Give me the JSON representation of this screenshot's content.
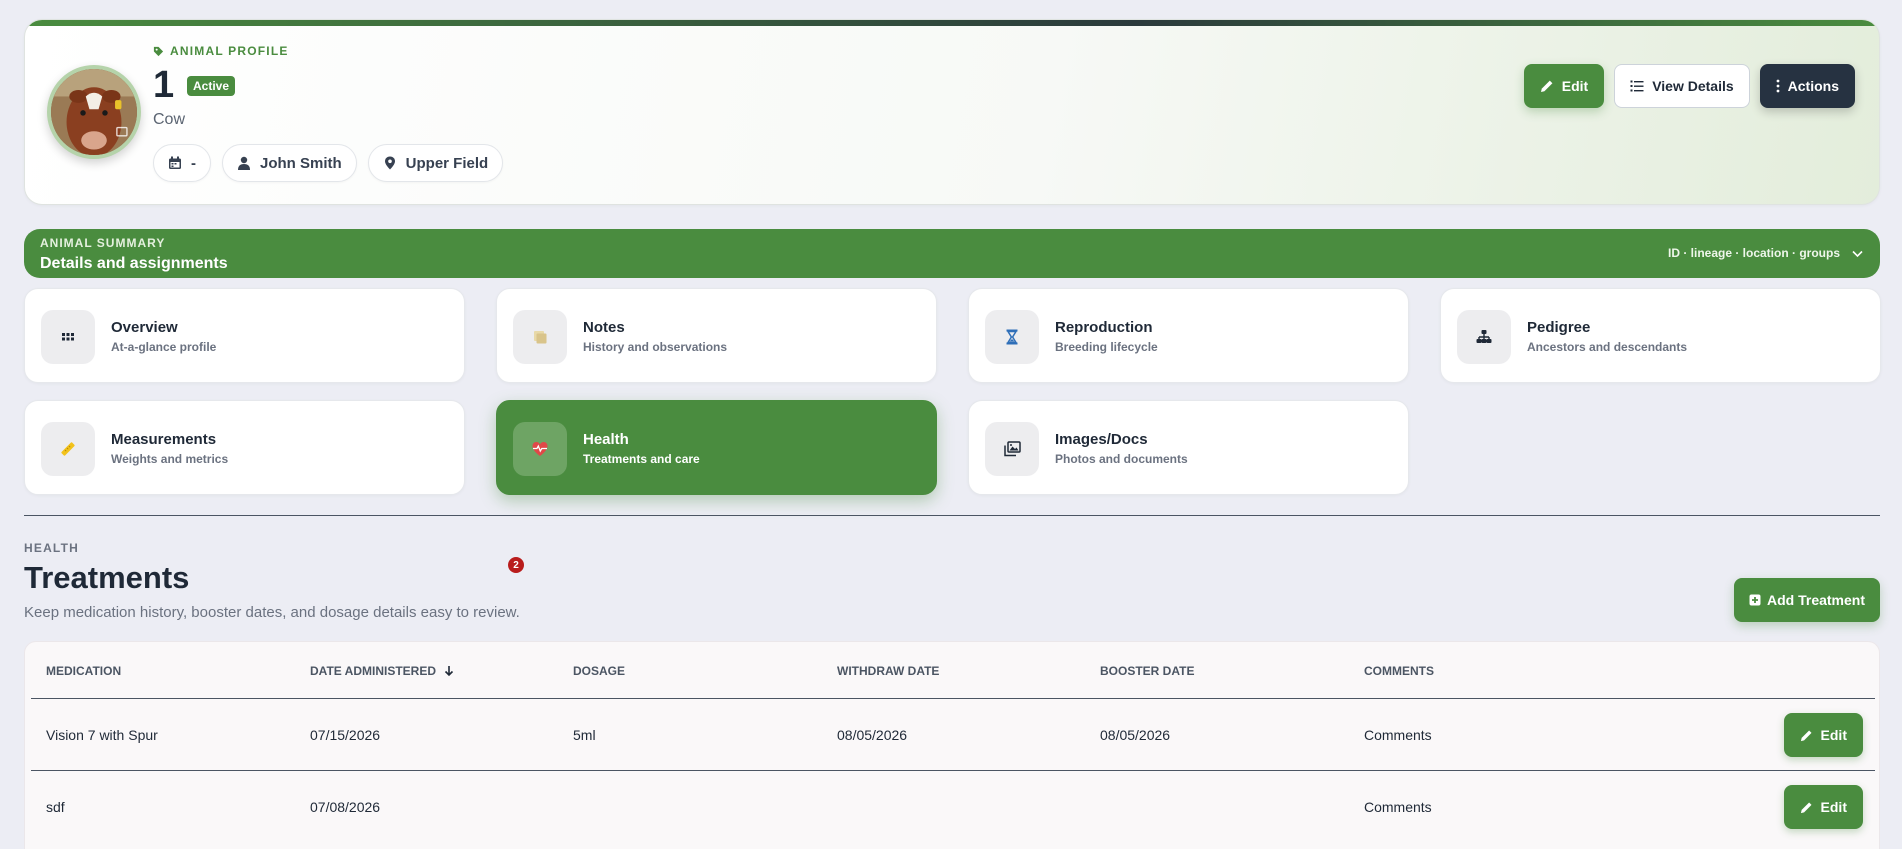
{
  "profile": {
    "eyebrow": "ANIMAL PROFILE",
    "animal_id": "1",
    "status": "Active",
    "species": "Cow",
    "chips": {
      "birth_date": "-",
      "owner": "John Smith",
      "location": "Upper Field"
    },
    "actions": {
      "edit": "Edit",
      "view_details": "View Details",
      "actions": "Actions"
    }
  },
  "summary": {
    "eyebrow": "ANIMAL SUMMARY",
    "title": "Details and assignments",
    "hint": "ID · lineage · location · groups"
  },
  "nav": {
    "overview": {
      "title": "Overview",
      "subtitle": "At-a-glance profile",
      "icon": "grid-icon"
    },
    "notes": {
      "title": "Notes",
      "subtitle": "History and observations",
      "icon": "notes-icon"
    },
    "reproduction": {
      "title": "Reproduction",
      "subtitle": "Breeding lifecycle",
      "icon": "hourglass-icon"
    },
    "pedigree": {
      "title": "Pedigree",
      "subtitle": "Ancestors and descendants",
      "icon": "sitemap-icon"
    },
    "measurements": {
      "title": "Measurements",
      "subtitle": "Weights and metrics",
      "icon": "ruler-icon"
    },
    "health": {
      "title": "Health",
      "subtitle": "Treatments and care",
      "icon": "heart-pulse-icon",
      "active": true
    },
    "images": {
      "title": "Images/Docs",
      "subtitle": "Photos and documents",
      "icon": "images-icon"
    }
  },
  "health": {
    "eyebrow": "HEALTH",
    "title": "Treatments",
    "count": "2",
    "description": "Keep medication history, booster dates, and dosage details easy to review.",
    "add_label": "Add Treatment"
  },
  "treatments": {
    "columns": {
      "medication": "MEDICATION",
      "date_administered": "DATE ADMINISTERED",
      "dosage": "DOSAGE",
      "withdraw_date": "WITHDRAW DATE",
      "booster_date": "BOOSTER DATE",
      "comments": "COMMENTS"
    },
    "sorted_by": "date_administered",
    "edit_label": "Edit",
    "rows": [
      {
        "medication": "Vision 7 with Spur",
        "date_administered": "07/15/2026",
        "dosage": "5ml",
        "withdraw_date": "08/05/2026",
        "booster_date": "08/05/2026",
        "comments": "Comments"
      },
      {
        "medication": "sdf",
        "date_administered": "07/08/2026",
        "dosage": "",
        "withdraw_date": "",
        "booster_date": "",
        "comments": "Comments"
      }
    ]
  },
  "colors": {
    "brand_green": "#4a8c3f",
    "dark": "#263241",
    "badge_red": "#b91c1c",
    "background": "#ecedf4"
  }
}
